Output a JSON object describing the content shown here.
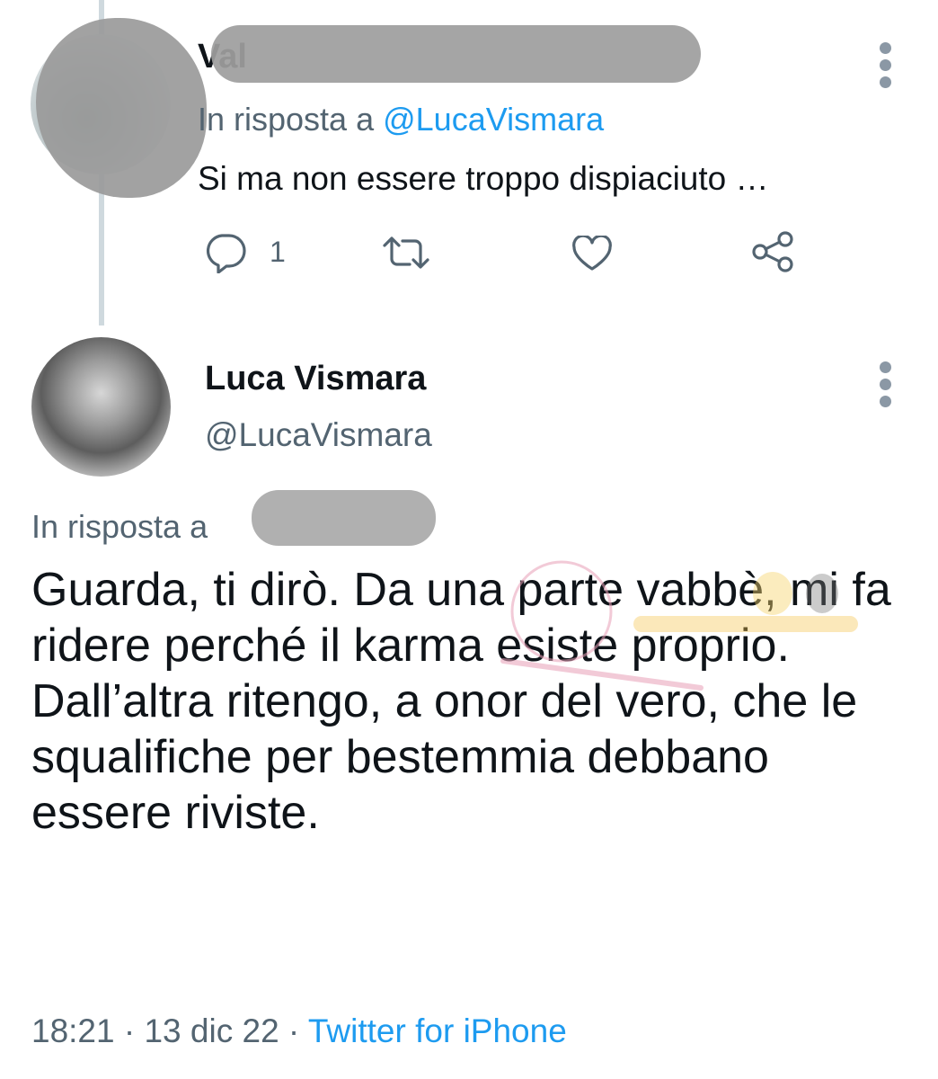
{
  "reply_tweet": {
    "author_name_visible": "Val",
    "reply_prefix": "In risposta a ",
    "reply_mention": "@LucaVismara",
    "text": "Si ma non essere troppo dispiaciuto …",
    "reply_count": "1",
    "actions": [
      "reply-icon",
      "retweet-icon",
      "like-icon",
      "share-icon"
    ]
  },
  "main_tweet": {
    "author_name": "Luca Vismara",
    "author_handle": "@LucaVismara",
    "reply_prefix": "In risposta a",
    "text": "Guarda, ti dirò. Da una parte vabbè, mi fa ridere perché il karma esiste proprio.\nDall’altra ritengo, a onor del vero, che le squalifiche per bestemmia debbano essere riviste.",
    "time": "18:21",
    "date": "13 dic 22",
    "separator": " · ",
    "source": "Twitter for iPhone"
  },
  "colors": {
    "accent": "#1d9bf0",
    "secondary_text": "#536471",
    "primary_text": "#0f1419",
    "thread_line": "#cfd9de"
  }
}
